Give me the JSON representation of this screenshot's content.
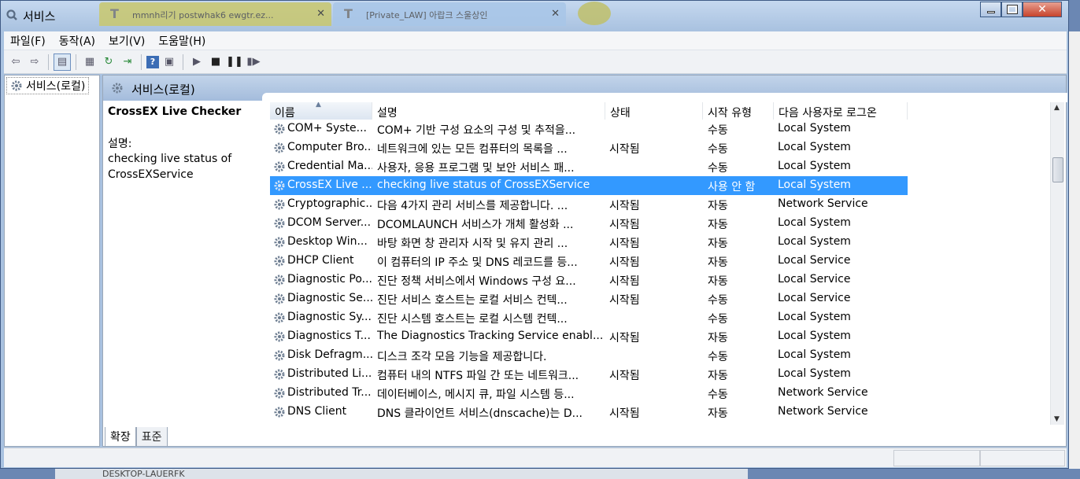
{
  "window": {
    "title": "서비스",
    "background_tabs": [
      "mmnh리기 postwhak6 ewgtr.ez...",
      "[Private_LAW] 아랍크 스울상인"
    ]
  },
  "menu": [
    "파일(F)",
    "동작(A)",
    "보기(V)",
    "도움말(H)"
  ],
  "toolbar": {
    "icons": [
      "back-arrow-icon",
      "forward-arrow-icon",
      "console-tree-icon",
      "properties-icon",
      "refresh-icon",
      "export-icon",
      "help-icon",
      "view-icon",
      "start-service-icon",
      "stop-service-icon",
      "pause-service-icon",
      "restart-service-icon"
    ]
  },
  "tree": {
    "root_label": "서비스(로컬)"
  },
  "panel": {
    "header_title": "서비스(로컬)",
    "selected_service_name": "CrossEX Live Checker",
    "description_label": "설명:",
    "description_text": "checking live status of CrossEXService"
  },
  "columns": [
    "이름",
    "설명",
    "상태",
    "시작 유형",
    "다음 사용자로 로그온"
  ],
  "services": [
    {
      "name": "COM+ Syste...",
      "desc": "COM+ 기반 구성 요소의 구성 및 추적을...",
      "status": "",
      "start": "수동",
      "logon": "Local System"
    },
    {
      "name": "Computer Bro...",
      "desc": "네트워크에 있는 모든 컴퓨터의 목록을 ...",
      "status": "시작됨",
      "start": "수동",
      "logon": "Local System"
    },
    {
      "name": "Credential Ma...",
      "desc": "사용자, 응용 프로그램 및 보안 서비스 패...",
      "status": "",
      "start": "수동",
      "logon": "Local System"
    },
    {
      "name": "CrossEX Live ...",
      "desc": "checking live status of CrossEXService",
      "status": "",
      "start": "사용 안 함",
      "logon": "Local System"
    },
    {
      "name": "Cryptographic...",
      "desc": "다음 4가지 관리 서비스를 제공합니다. ...",
      "status": "시작됨",
      "start": "자동",
      "logon": "Network Service"
    },
    {
      "name": "DCOM Server...",
      "desc": "DCOMLAUNCH 서비스가 개체 활성화 ...",
      "status": "시작됨",
      "start": "자동",
      "logon": "Local System"
    },
    {
      "name": "Desktop Win...",
      "desc": "바탕 화면 창 관리자 시작 및 유지 관리 ...",
      "status": "시작됨",
      "start": "자동",
      "logon": "Local System"
    },
    {
      "name": "DHCP Client",
      "desc": "이 컴퓨터의 IP 주소 및 DNS 레코드를 등...",
      "status": "시작됨",
      "start": "자동",
      "logon": "Local Service"
    },
    {
      "name": "Diagnostic Po...",
      "desc": "진단 정책 서비스에서 Windows 구성 요...",
      "status": "시작됨",
      "start": "자동",
      "logon": "Local Service"
    },
    {
      "name": "Diagnostic Se...",
      "desc": "진단 서비스 호스트는 로컬 서비스 컨텍...",
      "status": "시작됨",
      "start": "수동",
      "logon": "Local Service"
    },
    {
      "name": "Diagnostic Sy...",
      "desc": "진단 시스템 호스트는 로컬 시스템 컨텍...",
      "status": "",
      "start": "수동",
      "logon": "Local System"
    },
    {
      "name": "Diagnostics T...",
      "desc": "The Diagnostics Tracking Service enabl...",
      "status": "시작됨",
      "start": "자동",
      "logon": "Local System"
    },
    {
      "name": "Disk Defragm...",
      "desc": "디스크 조각 모음 기능을 제공합니다.",
      "status": "",
      "start": "수동",
      "logon": "Local System"
    },
    {
      "name": "Distributed Li...",
      "desc": "컴퓨터 내의 NTFS 파일 간 또는 네트워크...",
      "status": "시작됨",
      "start": "자동",
      "logon": "Local System"
    },
    {
      "name": "Distributed Tr...",
      "desc": "데이터베이스, 메시지 큐, 파일 시스템 등...",
      "status": "",
      "start": "수동",
      "logon": "Network Service"
    },
    {
      "name": "DNS Client",
      "desc": "DNS 클라이언트 서비스(dnscache)는 D...",
      "status": "시작됨",
      "start": "자동",
      "logon": "Network Service"
    }
  ],
  "selected_index": 3,
  "bottom_tabs": [
    "확장",
    "표준"
  ],
  "taskbar_peek": "DESKTOP-LAUERFK",
  "colors": {
    "selection": "#3399ff",
    "header": "#a4bcdc"
  }
}
